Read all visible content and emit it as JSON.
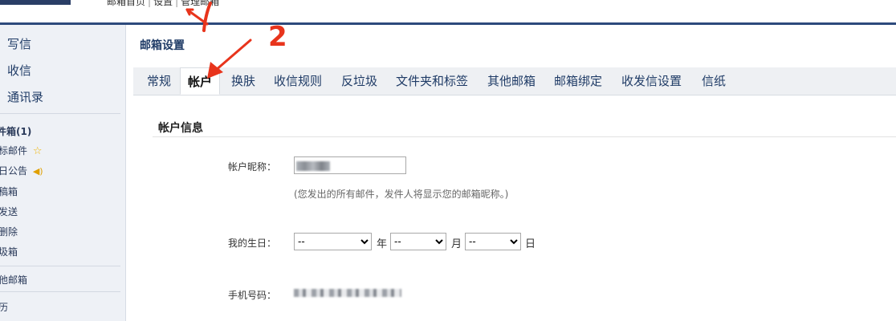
{
  "header": {
    "links": [
      "邮箱首页",
      "设置",
      "管理邮箱"
    ]
  },
  "sidebar": {
    "main": [
      "写信",
      "收信",
      "通讯录"
    ],
    "folders": [
      "件箱(1)",
      "标邮件",
      "日公告",
      "稿箱",
      "发送",
      "删除",
      "圾箱"
    ],
    "other_label": "他邮箱",
    "bottom_label": "历"
  },
  "page": {
    "title": "邮箱设置",
    "tabs": [
      "常规",
      "帐户",
      "换肤",
      "收信规则",
      "反垃圾",
      "文件夹和标签",
      "其他邮箱",
      "邮箱绑定",
      "收发信设置",
      "信纸"
    ],
    "active_tab": "帐户"
  },
  "account": {
    "section_title": "帐户信息",
    "nickname_label": "帐户昵称：",
    "nickname_hint": "(您发出的所有邮件，发件人将显示您的邮箱昵称。)",
    "birthday_label": "我的生日：",
    "year_value": "--",
    "year_unit": "年",
    "month_value": "--",
    "month_unit": "月",
    "day_value": "--",
    "day_unit": "日",
    "phone_label": "手机号码："
  },
  "annotations": {
    "step2": "2",
    "arrow_color": "#e8341c"
  }
}
